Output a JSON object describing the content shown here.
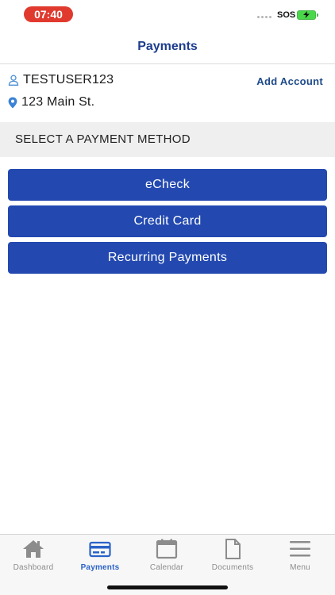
{
  "status_bar": {
    "time": "07:40",
    "carrier": "SOS"
  },
  "header": {
    "title": "Payments"
  },
  "account": {
    "username": "TESTUSER123",
    "address": "123 Main St.",
    "add_account_label": "Add Account"
  },
  "section": {
    "title": "SELECT A PAYMENT METHOD"
  },
  "payment_methods": [
    "eCheck",
    "Credit Card",
    "Recurring Payments"
  ],
  "tabs": [
    {
      "label": "Dashboard",
      "icon": "home-icon"
    },
    {
      "label": "Payments",
      "icon": "credit-card-icon"
    },
    {
      "label": "Calendar",
      "icon": "calendar-icon"
    },
    {
      "label": "Documents",
      "icon": "document-icon"
    },
    {
      "label": "Menu",
      "icon": "menu-icon"
    }
  ],
  "colors": {
    "primary": "#2349b0",
    "title": "#1e3d8f",
    "active_tab": "#2b63c7",
    "time_pill": "#e03a2f"
  }
}
